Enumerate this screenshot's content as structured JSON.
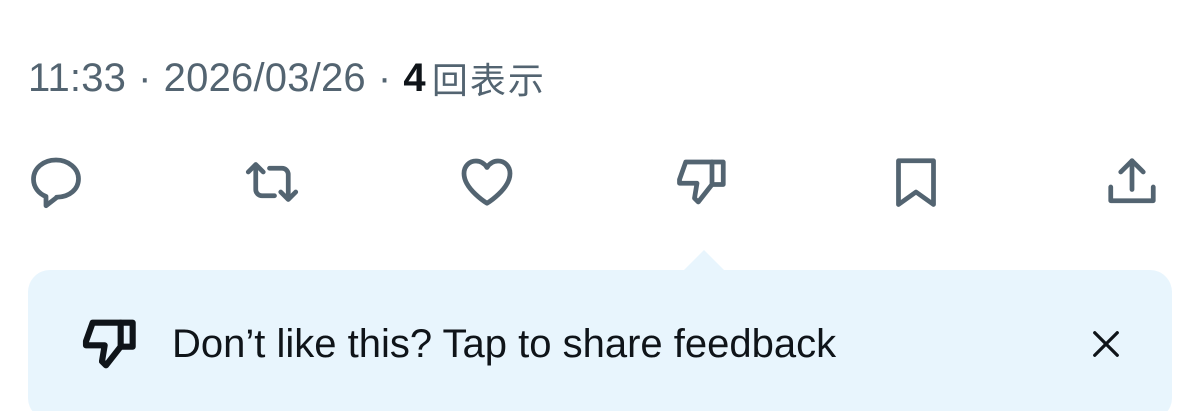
{
  "post_meta": {
    "time": "11:33",
    "separator": "·",
    "date": "2026/03/26",
    "views_count": "4",
    "views_label": "回表示"
  },
  "actions": [
    {
      "name": "reply",
      "icon": "reply-icon"
    },
    {
      "name": "repost",
      "icon": "repost-icon"
    },
    {
      "name": "like",
      "icon": "heart-icon"
    },
    {
      "name": "dislike",
      "icon": "thumbs-down-icon"
    },
    {
      "name": "bookmark",
      "icon": "bookmark-icon"
    },
    {
      "name": "share",
      "icon": "share-icon"
    }
  ],
  "feedback_banner": {
    "icon": "thumbs-down-icon",
    "text": "Don’t like this? Tap to share feedback",
    "close_icon": "close-icon"
  },
  "colors": {
    "icon_gray": "#536471",
    "text_dark": "#0f1419",
    "banner_bg": "#e8f5fd"
  }
}
